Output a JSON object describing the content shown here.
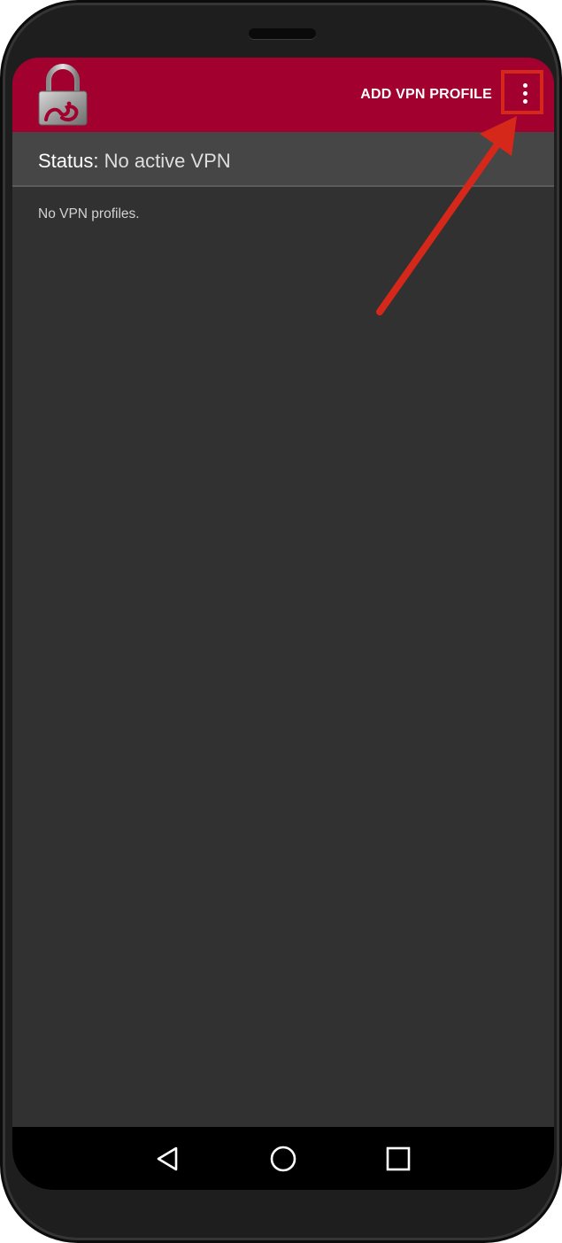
{
  "appbar": {
    "logo_icon": "padlock-strongswan-icon",
    "add_profile_label": "ADD VPN PROFILE",
    "menu_icon": "more-vert-icon",
    "background_color": "#a2002f"
  },
  "status": {
    "label": "Status:",
    "value": "No active VPN"
  },
  "content": {
    "empty_message": "No VPN profiles."
  },
  "navigation": {
    "back_icon": "back-triangle-icon",
    "home_icon": "home-circle-icon",
    "recents_icon": "recents-square-icon"
  },
  "annotation": {
    "color": "#d6281a"
  }
}
